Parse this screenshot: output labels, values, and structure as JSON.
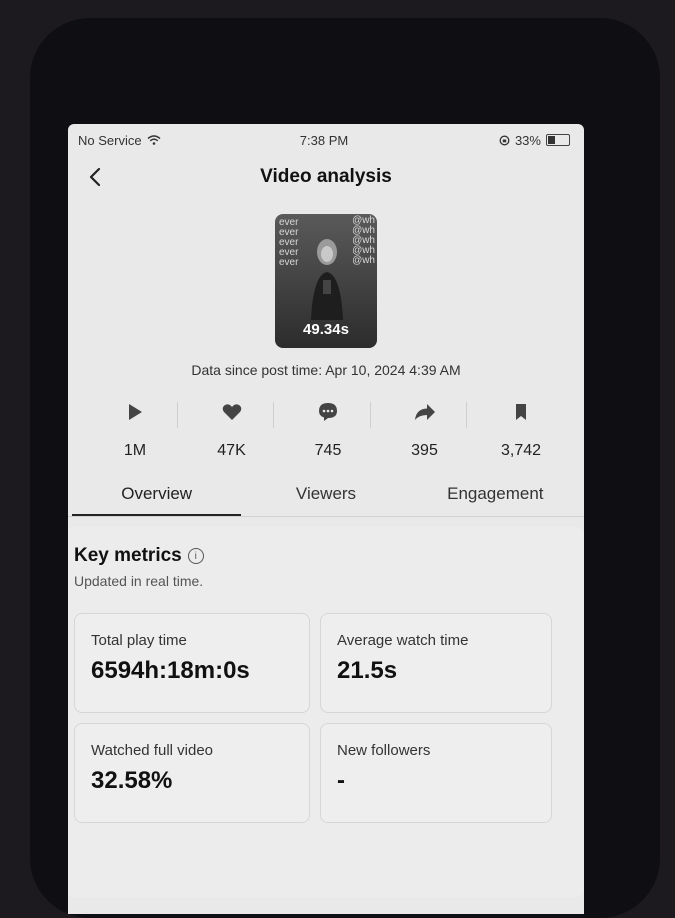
{
  "status_bar": {
    "carrier": "No Service",
    "time": "7:38 PM",
    "battery": "33%",
    "battery_level": 0.33
  },
  "header": {
    "title": "Video analysis"
  },
  "video": {
    "duration": "49.34s",
    "data_since": "Data since post time: Apr 10, 2024 4:39 AM"
  },
  "stats": [
    {
      "icon": "play-icon",
      "value": "1M"
    },
    {
      "icon": "heart-icon",
      "value": "47K"
    },
    {
      "icon": "comment-icon",
      "value": "745"
    },
    {
      "icon": "share-icon",
      "value": "395"
    },
    {
      "icon": "bookmark-icon",
      "value": "3,742"
    }
  ],
  "tabs": [
    {
      "label": "Overview",
      "active": true
    },
    {
      "label": "Viewers",
      "active": false
    },
    {
      "label": "Engagement",
      "active": false
    }
  ],
  "key_metrics": {
    "title": "Key metrics",
    "subtitle": "Updated in real time.",
    "items": [
      {
        "label": "Total play time",
        "value": "6594h:18m:0s"
      },
      {
        "label": "Average watch time",
        "value": "21.5s"
      },
      {
        "label": "Watched full video",
        "value": "32.58%"
      },
      {
        "label": "New followers",
        "value": "-"
      }
    ]
  }
}
